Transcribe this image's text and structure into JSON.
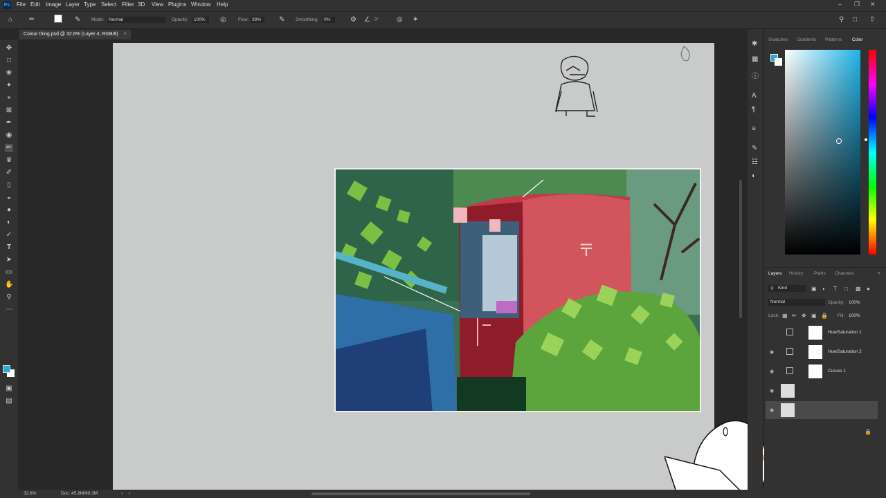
{
  "app": {
    "logo": "Ps"
  },
  "menu": [
    "File",
    "Edit",
    "Image",
    "Layer",
    "Type",
    "Select",
    "Filter",
    "3D",
    "View",
    "Plugins",
    "Window",
    "Help"
  ],
  "options": {
    "mode_label": "Mode:",
    "mode_value": "Normal",
    "opacity_label": "Opacity:",
    "opacity_value": "100%",
    "flow_label": "Flow:",
    "flow_value": "38%",
    "smoothing_label": "Smoothing:",
    "smoothing_value": "0%",
    "angle_value": "0°"
  },
  "document": {
    "tab_title": "Colour thing.psd @ 32.6% (Layer 4, RGB/8)"
  },
  "color_panel": {
    "tabs": [
      "Swatches",
      "Gradients",
      "Patterns",
      "Color"
    ],
    "active_tab": "Color",
    "foreground": "#2aa9d4",
    "background": "#ffffff"
  },
  "layers_panel": {
    "tabs": [
      "Layers",
      "History",
      "Paths",
      "Channels"
    ],
    "kind_label": "Kind",
    "blend_mode": "Normal",
    "opacity_label": "Opacity:",
    "opacity_value": "100%",
    "lock_label": "Lock:",
    "fill_label": "Fill:",
    "fill_value": "100%",
    "layers": [
      {
        "name": "Hue/Saturation 1"
      },
      {
        "name": "Hue/Saturation 2"
      },
      {
        "name": "Curves 1"
      }
    ]
  },
  "status": {
    "zoom": "32.6%",
    "doc_info": "Doc: 45.8M/90.3M"
  }
}
